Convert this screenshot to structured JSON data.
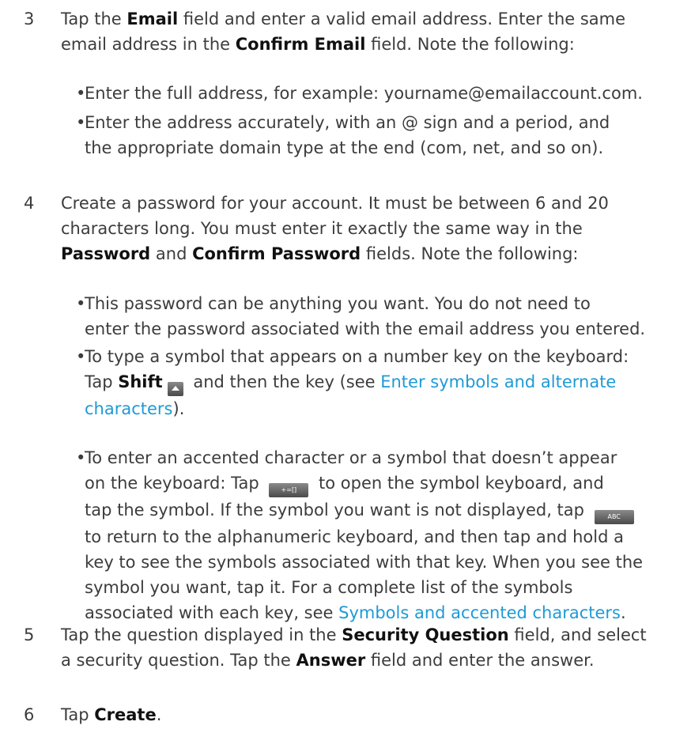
{
  "steps": {
    "s3": {
      "number": "3",
      "line1": {
        "a": "Tap the ",
        "b": "Email",
        "c": " field and enter a valid email address. Enter the same"
      },
      "line2": {
        "a": "email address in the ",
        "b": "Confirm Email",
        "c": " field. Note the following:"
      },
      "bullet1": "Enter the full address, for example: yourname@emailaccount.com.",
      "bullet2": {
        "line1": "Enter the address accurately, with an @ sign and a period, and",
        "line2": "the appropriate domain type at the end (com, net, and so on)."
      }
    },
    "s4": {
      "number": "4",
      "line1": "Create a password for your account. It must be between 6 and 20",
      "line2": "characters long. You must enter it exactly the same way in the",
      "line3": {
        "b1": "Password",
        "a": " and ",
        "b2": "Confirm Password",
        "c": " fields. Note the following:"
      },
      "bullet1": {
        "line1": "This password can be anything you want. You do not need to",
        "line2": "enter the password associated with the email address you entered."
      },
      "bullet2": {
        "line1": "To type a symbol that appears on a number key on the keyboard:",
        "line2": {
          "a": "Tap ",
          "b": "Shift",
          "c": " and then the key (see ",
          "link": "Enter symbols and alternate"
        },
        "line3": {
          "link": "characters",
          "c": ")."
        }
      },
      "bullet3": {
        "line1": "To enter an accented character or a symbol that doesn’t appear",
        "line2": {
          "a": "on the keyboard: Tap ",
          "c": " to open the symbol keyboard, and"
        },
        "line3": {
          "a": "tap the symbol. If the symbol you want is not displayed, tap "
        },
        "line4": "to return to the alphanumeric keyboard, and then tap and hold a",
        "line5": "key to see the symbols associated with that key. When you see the",
        "line6": "symbol you want, tap it. For a complete list of the symbols",
        "line7": {
          "a": "associated with each key, see ",
          "link": "Symbols and accented characters",
          "c": "."
        }
      },
      "keys": {
        "symbol_key": "+=[]",
        "abc_key": "ABC",
        "shift_icon": "shift-arrow-icon"
      }
    },
    "s5": {
      "number": "5",
      "line1": {
        "a": "Tap the question displayed in the ",
        "b": "Security Question",
        "c": " field, and select"
      },
      "line2": {
        "a": "a security question. Tap the ",
        "b": "Answer",
        "c": " field and enter the answer."
      }
    },
    "s6": {
      "number": "6",
      "line1": {
        "a": "Tap ",
        "b": "Create",
        "c": "."
      }
    }
  },
  "colors": {
    "text": "#3c3c3c",
    "bold": "#111111",
    "link": "#1e9ad6"
  }
}
